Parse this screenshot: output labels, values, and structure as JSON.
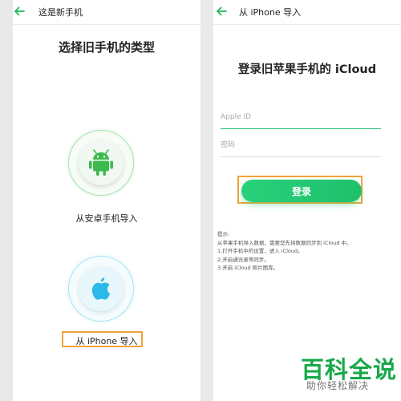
{
  "left_screen": {
    "topbar_title": "这是新手机",
    "heading": "选择旧手机的类型",
    "options": [
      {
        "label": "从安卓手机导入",
        "icon": "android-icon",
        "color": "#3dba4e"
      },
      {
        "label": "从 iPhone 导入",
        "icon": "apple-icon",
        "color": "#2db8ea",
        "highlighted": true
      }
    ]
  },
  "right_screen": {
    "topbar_title": "从 iPhone 导入",
    "heading": "登录旧苹果手机的 iCloud",
    "apple_id_placeholder": "Apple ID",
    "password_placeholder": "密码",
    "login_button": "登录",
    "tips": [
      "提示:",
      "从苹果手机导入数据，需要您先将数据同步到 iCloud 中。",
      "1.打开手机中的设置，进入 iCloud。",
      "2.开启通讯录等同步。",
      "3.开启 iCloud 照片图库。"
    ]
  },
  "watermark": {
    "main": "百科全说",
    "sub": "助你轻松解决"
  },
  "colors": {
    "accent_green": "#1fc06c",
    "highlight_orange": "#f0a23a",
    "back_arrow_green": "#1fb85b"
  }
}
